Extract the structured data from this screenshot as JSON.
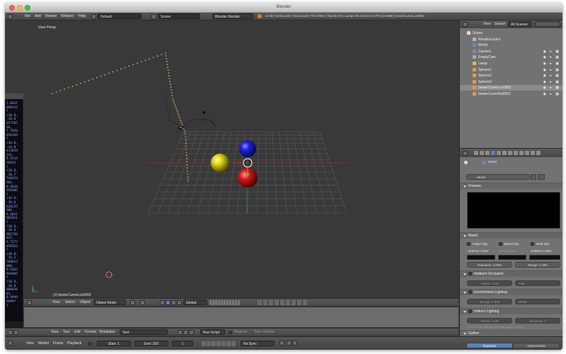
{
  "window": {
    "title": "Blender"
  },
  "topbar": {
    "menus": [
      "File",
      "Add",
      "Render",
      "Window",
      "Help"
    ],
    "layout": "Default",
    "scene": "Scene",
    "engine": "Blender Render",
    "stats": "v2.69 | Verts:1146 | Faces:1136 | Tris:2060 | Objects:1/8 | Lamps:0/1 | Mem:14.37M (10.59M) | besierCurveLoc0002"
  },
  "console": {
    "lines": [
      "7.0667",
      "898416",
      "?",
      "(10.0,",
      "-10.0",
      "657207",
      "40,",
      "7.7850",
      "858189",
      "?",
      "(10.0,",
      "-10.0",
      "413650",
      "141,",
      "8.4214",
      "10291",
      "?",
      "(10.0,",
      "-10.7",
      "749423",
      "981,",
      "8.9634",
      "656906",
      "?",
      "(10.0,",
      "-10.6",
      "620225",
      "986,",
      "9.4021",
      "883011",
      "?",
      "(10.0,",
      "-10.4",
      "981784",
      "021,",
      "9.7277",
      "458562",
      "?",
      "(10.0,",
      "-10.2",
      "789812",
      "000,",
      "9.9302",
      "949985",
      "?",
      "(10.0,",
      "-10.0",
      "000020",
      "61,",
      "9.9999",
      "99997",
      "?",
      ">>>"
    ]
  },
  "viewport": {
    "view_label": "User Persp",
    "object_label": "(1) besierCurveLoc0002"
  },
  "viewport_header": {
    "menus": [
      "View",
      "Select",
      "Object"
    ],
    "mode": "Object Mode",
    "orientation": "Global"
  },
  "text_editor_header": {
    "menus": [
      "View",
      "Text",
      "Edit",
      "Format",
      "Templates"
    ],
    "text_name": "Text",
    "run_script": "Run Script",
    "register": "Register",
    "text_internal": "Text: Internal"
  },
  "timeline": {
    "menus": [
      "View",
      "Marker",
      "Frame",
      "Playback"
    ],
    "start": "Start: 1",
    "end": "End: 250",
    "current": "1",
    "sync": "No Sync"
  },
  "outliner": {
    "header_view": "View",
    "header_search": "Search",
    "header_scenes": "All Scenes",
    "items": [
      {
        "label": "Scene",
        "depth": 0
      },
      {
        "label": "RenderLayers",
        "depth": 1
      },
      {
        "label": "World",
        "depth": 1
      },
      {
        "label": "Camera",
        "depth": 1
      },
      {
        "label": "EmptyCam",
        "depth": 1
      },
      {
        "label": "Lamp",
        "depth": 1
      },
      {
        "label": "Sphere1",
        "depth": 1
      },
      {
        "label": "Sphere2",
        "depth": 1
      },
      {
        "label": "Sphere3",
        "depth": 1
      },
      {
        "label": "besierCurveLoc0002",
        "depth": 1
      },
      {
        "label": "besierCurveRot0002",
        "depth": 1
      }
    ]
  },
  "properties": {
    "context": "World",
    "world_name": "World",
    "preview_panel": "Preview",
    "world_panel": "World",
    "paper_sky": "Paper Sky",
    "blend_sky": "Blend Sky",
    "real_sky": "Real Sky",
    "horizon_color": "Horizon Color:",
    "zenith_color": "Zenith Color:",
    "ambient_color": "Ambient Color:",
    "exposure": "Exposure: 0.000",
    "range": "Range: 1.000",
    "ambient_occlusion": "Ambient Occlusion",
    "ao_factor": "Factor: 1.00",
    "ao_mode": "Add",
    "environment_lighting": "Environment Lighting",
    "env_energy": "Energy: 1.000",
    "env_color": "White",
    "indirect_lighting": "Indirect Lighting",
    "ind_factor": "Factor: 1.00",
    "ind_bounces": "Bounces: 1",
    "indirect_note": "Only works with Approximate gather method",
    "gather_panel": "Gather",
    "raytrace": "Raytrace",
    "approximate": "Approximate"
  }
}
